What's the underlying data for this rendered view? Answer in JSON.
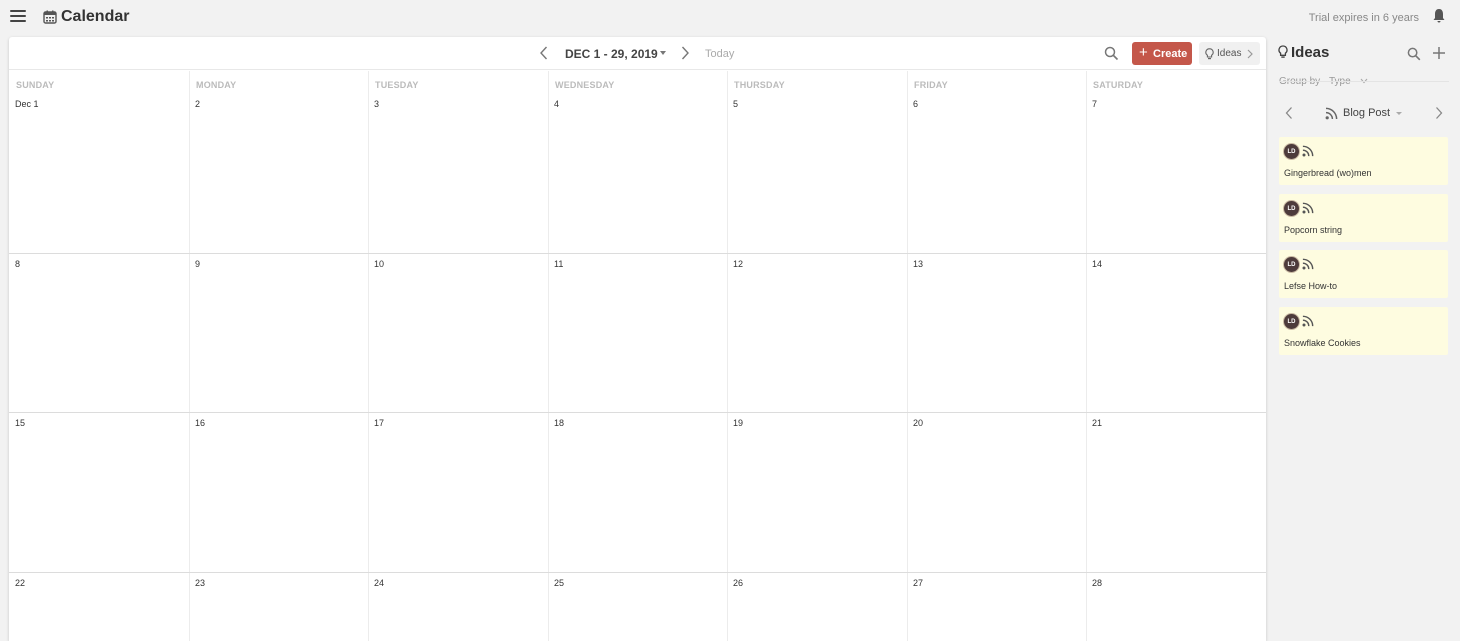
{
  "app": {
    "title": "Calendar",
    "trial_text": "Trial expires in 6 years"
  },
  "calendar": {
    "range_label": "DEC 1 - 29, 2019",
    "today_label": "Today",
    "create_label": "Create",
    "ideas_toggle_label": "Ideas",
    "weekdays": [
      "SUNDAY",
      "MONDAY",
      "TUESDAY",
      "WEDNESDAY",
      "THURSDAY",
      "FRIDAY",
      "SATURDAY"
    ],
    "weeks": [
      [
        "Dec 1",
        "2",
        "3",
        "4",
        "5",
        "6",
        "7"
      ],
      [
        "8",
        "9",
        "10",
        "11",
        "12",
        "13",
        "14"
      ],
      [
        "15",
        "16",
        "17",
        "18",
        "19",
        "20",
        "21"
      ],
      [
        "22",
        "23",
        "24",
        "25",
        "26",
        "27",
        "28"
      ]
    ]
  },
  "ideas": {
    "title": "Ideas",
    "group_by_label": "Group by",
    "group_by_value": "Type",
    "group_label": "Blog Post",
    "items": [
      {
        "initials": "LD",
        "title": "Gingerbread (wo)men"
      },
      {
        "initials": "LD",
        "title": "Popcorn string"
      },
      {
        "initials": "LD",
        "title": "Lefse How-to"
      },
      {
        "initials": "LD",
        "title": "Snowflake Cookies"
      }
    ]
  },
  "colors": {
    "create_button": "#c4574a",
    "idea_card": "#fefce0",
    "avatar": "#4d3b3b"
  }
}
